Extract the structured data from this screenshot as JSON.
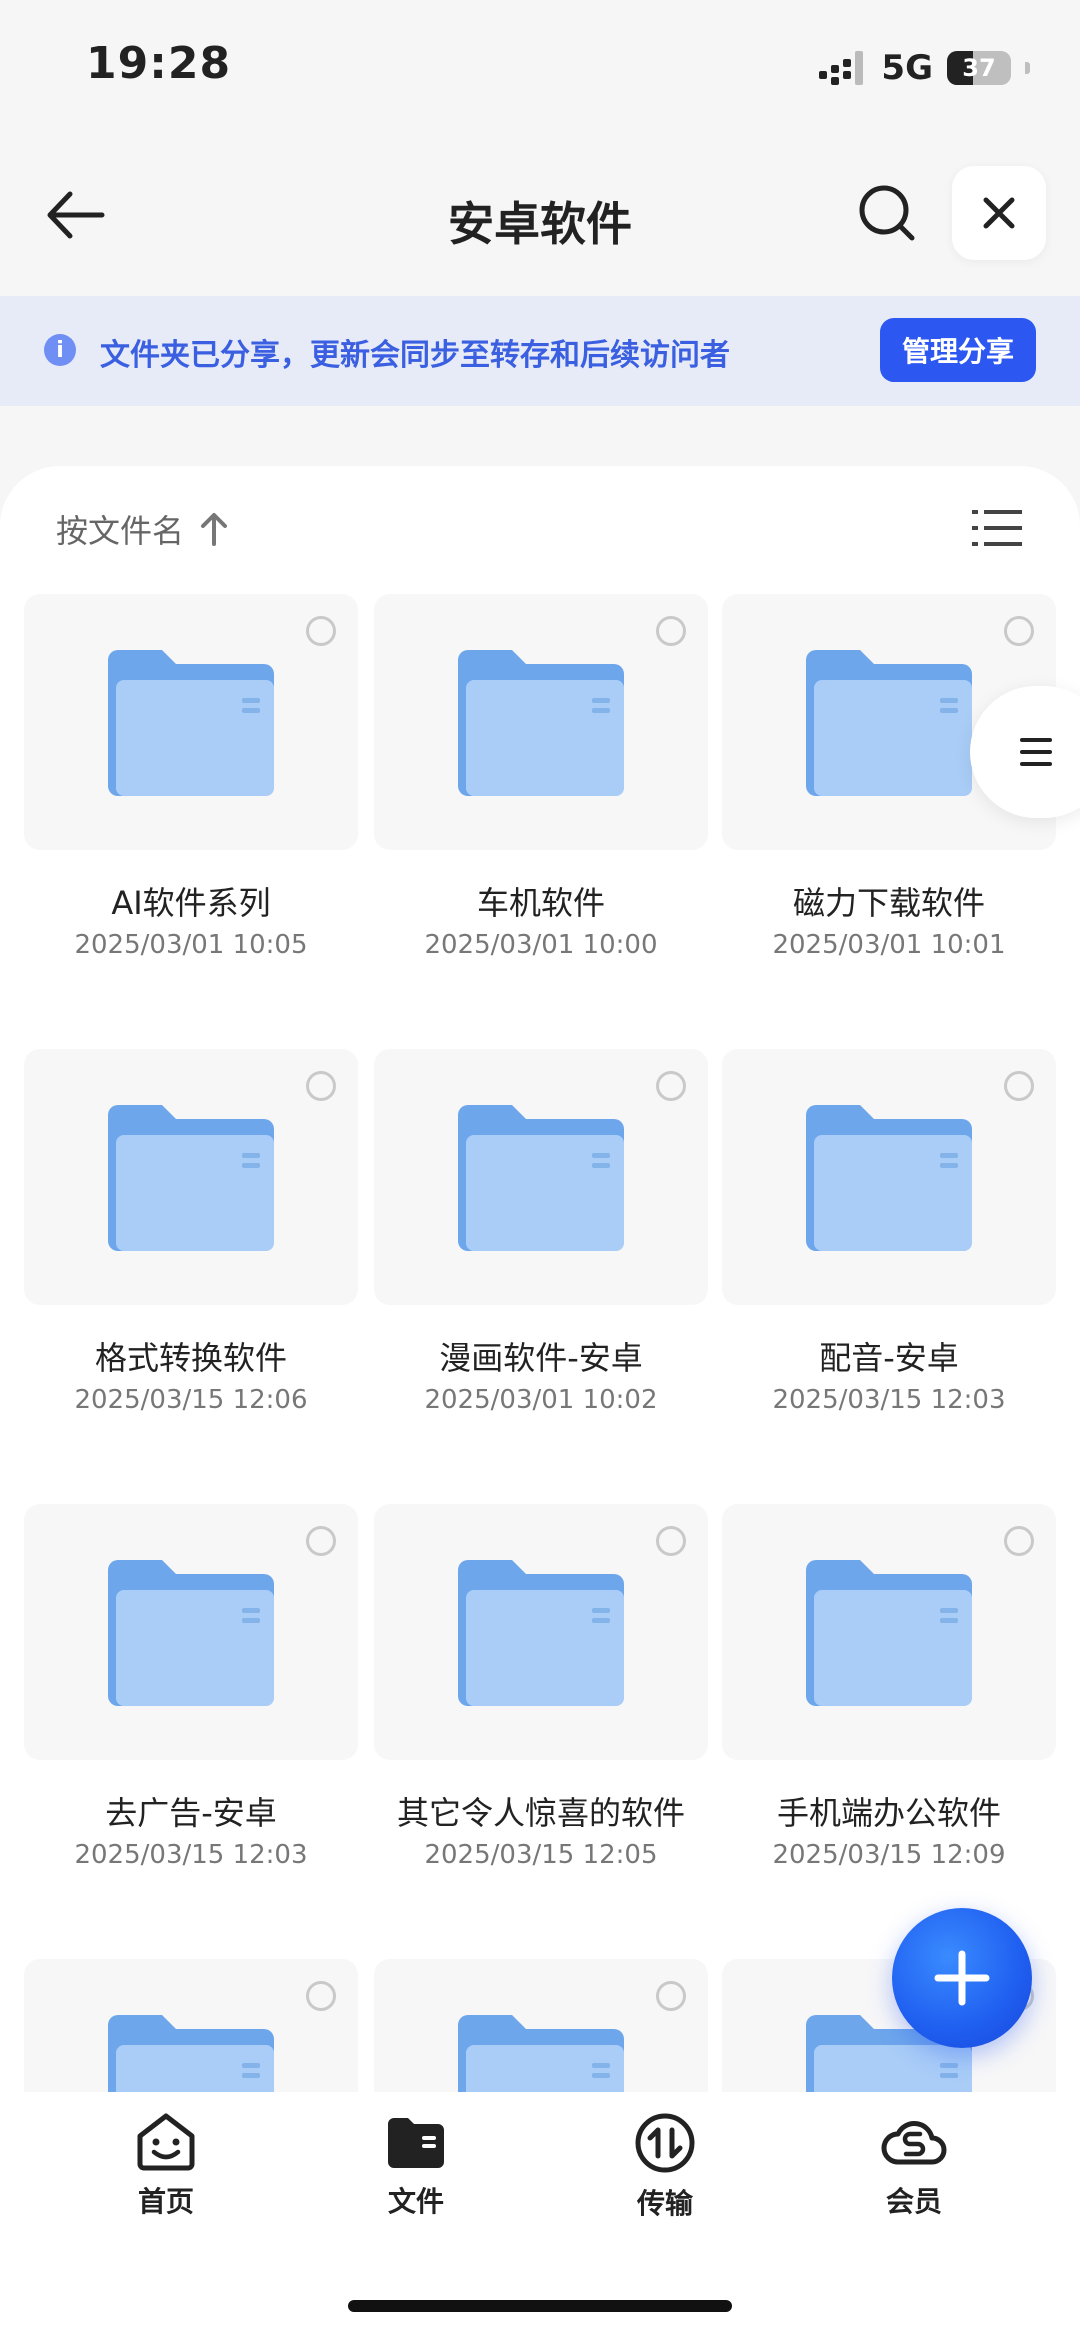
{
  "status_bar": {
    "time": "19:28",
    "network": "5G",
    "battery": "37"
  },
  "header": {
    "title": "安卓软件"
  },
  "banner": {
    "text": "文件夹已分享，更新会同步至转存和后续访问者",
    "button": "管理分享"
  },
  "sort": {
    "label": "按文件名"
  },
  "files": [
    {
      "name": "AI软件系列",
      "date": "2025/03/01 10:05"
    },
    {
      "name": "车机软件",
      "date": "2025/03/01 10:00"
    },
    {
      "name": "磁力下载软件",
      "date": "2025/03/01 10:01"
    },
    {
      "name": "格式转换软件",
      "date": "2025/03/15 12:06"
    },
    {
      "name": "漫画软件-安卓",
      "date": "2025/03/01 10:02"
    },
    {
      "name": "配音-安卓",
      "date": "2025/03/15 12:03"
    },
    {
      "name": "去广告-安卓",
      "date": "2025/03/15 12:03"
    },
    {
      "name": "其它令人惊喜的软件",
      "date": "2025/03/15 12:05"
    },
    {
      "name": "手机端办公软件",
      "date": "2025/03/15 12:09"
    },
    {
      "name": "",
      "date": ""
    },
    {
      "name": "",
      "date": ""
    },
    {
      "name": "",
      "date": ""
    }
  ],
  "tabs": [
    {
      "label": "首页"
    },
    {
      "label": "文件"
    },
    {
      "label": "传输"
    },
    {
      "label": "会员"
    }
  ],
  "colors": {
    "accent": "#2c57f0",
    "folder": "#7fb1f0",
    "banner_bg": "#e7ebf8"
  }
}
